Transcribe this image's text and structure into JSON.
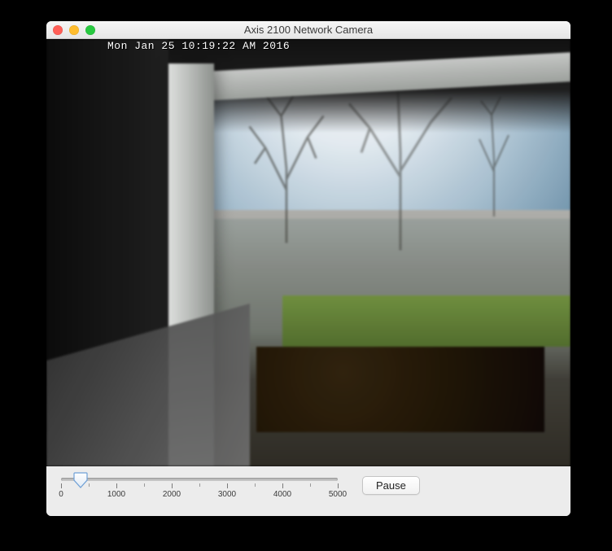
{
  "window": {
    "title": "Axis 2100 Network Camera"
  },
  "video": {
    "timestamp": "Mon Jan 25  10:19:22 AM  2016"
  },
  "controls": {
    "pause_label": "Pause",
    "slider": {
      "min": 0,
      "max": 5000,
      "value": 350,
      "major_ticks": [
        0,
        1000,
        2000,
        3000,
        4000,
        5000
      ],
      "tick_labels": [
        "0",
        "1000",
        "2000",
        "3000",
        "4000",
        "5000"
      ]
    }
  }
}
